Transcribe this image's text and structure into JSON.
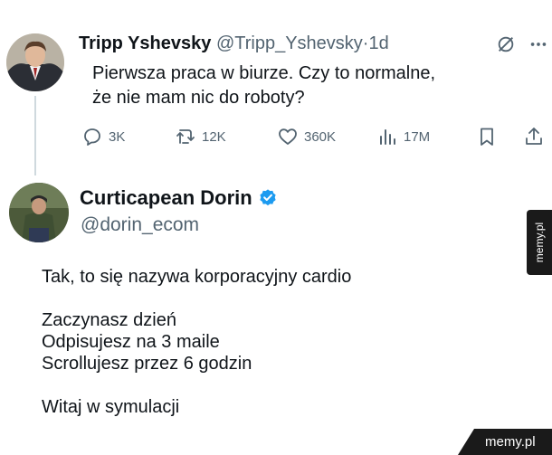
{
  "tweet1": {
    "display_name": "Tripp Yshevsky",
    "handle": "@Tripp_Yshevsky",
    "separator": "·",
    "time": "1d",
    "text": "Pierwsza praca w biurze. Czy to normalne, że nie mam nic do roboty?",
    "actions": {
      "replies": "3K",
      "reposts": "12K",
      "likes": "360K",
      "views": "17M"
    }
  },
  "tweet2": {
    "display_name": "Curticapean Dorin",
    "handle": "@dorin_ecom",
    "verified": true,
    "lines": [
      "Tak, to się nazywa korporacyjny cardio",
      "",
      "Zaczynasz dzień",
      "Odpisujesz na 3 maile",
      "Scrollujesz przez 6 godzin",
      "",
      "Witaj w symulacji"
    ]
  },
  "watermarks": {
    "side": "memy.pl",
    "bottom": "memy.pl"
  },
  "colors": {
    "text": "#0f1419",
    "secondary": "#536471",
    "verified": "#1d9bf0",
    "thread_line": "#cfd9de"
  }
}
